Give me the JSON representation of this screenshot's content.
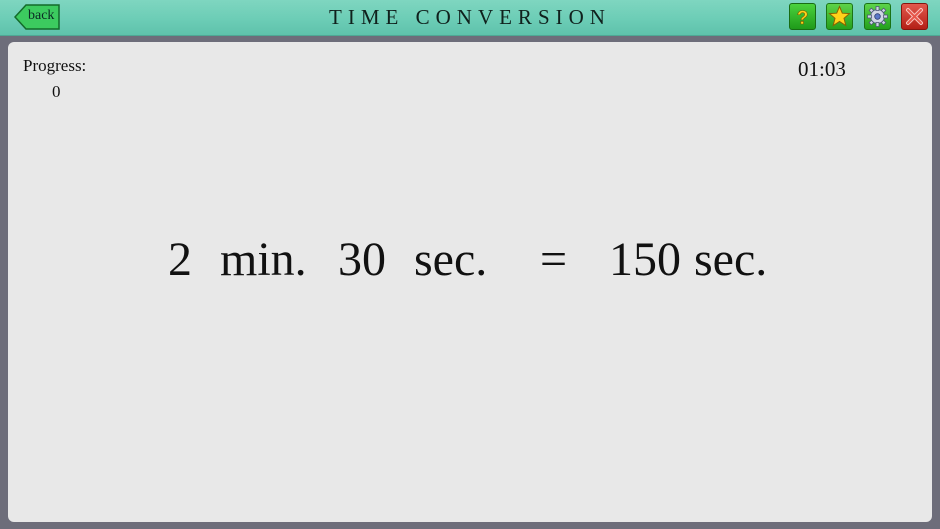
{
  "header": {
    "back_label": "back",
    "title": "TIME CONVERSION",
    "buttons": {
      "help": "help-icon",
      "favorite": "star-icon",
      "settings": "gear-icon",
      "close": "close-icon"
    }
  },
  "status": {
    "progress_label": "Progress:",
    "progress_value": "0",
    "timer": "01:03"
  },
  "equation": {
    "minutes": "2",
    "minutes_unit": "min.",
    "seconds": "30",
    "seconds_unit": "sec.",
    "equals": "=",
    "answer": "150",
    "answer_unit": "sec."
  },
  "colors": {
    "header": "#6ccdb6",
    "panel": "#e8e8e8",
    "frame": "#6d6d7a",
    "green_button": "#2fae26",
    "red_button": "#c8281e"
  }
}
